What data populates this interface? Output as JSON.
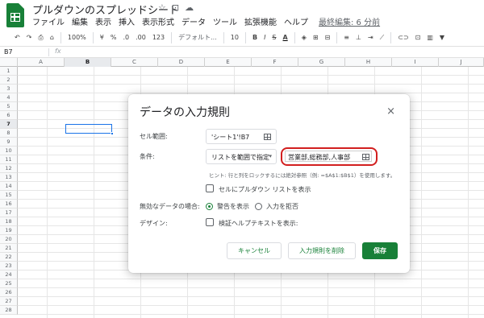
{
  "document": {
    "title": "プルダウンのスプレッドシート",
    "title_icons": [
      "☆",
      "⊡",
      "☁"
    ],
    "last_edit": "最終編集: 6 分前"
  },
  "menu": [
    "ファイル",
    "編集",
    "表示",
    "挿入",
    "表示形式",
    "データ",
    "ツール",
    "拡張機能",
    "ヘルプ"
  ],
  "toolbar": {
    "zoom": "100%",
    "currency": "¥",
    "percent": "%",
    "decimal_decrease": ".0",
    "decimal_increase": ".00",
    "number_format": "123",
    "font": "デフォルト...",
    "font_size": "10",
    "bold": "B",
    "italic": "I",
    "strike": "S",
    "text_color": "A"
  },
  "formula_bar": {
    "cell_ref": "B7",
    "fx": "fx"
  },
  "sheet": {
    "columns": [
      "A",
      "B",
      "C",
      "D",
      "E",
      "F",
      "G",
      "H",
      "I",
      "J"
    ],
    "selected_column": "B",
    "rows": [
      "1",
      "2",
      "3",
      "4",
      "5",
      "6",
      "7",
      "8",
      "9",
      "10",
      "11",
      "12",
      "13",
      "14",
      "15",
      "16",
      "17",
      "18",
      "19",
      "20",
      "21",
      "22",
      "23",
      "24",
      "25",
      "26",
      "27",
      "28"
    ],
    "selected_row": "7"
  },
  "dialog": {
    "title": "データの入力規則",
    "close": "×",
    "range_label": "セル範囲:",
    "range_value": "'シート1'!B7",
    "criteria_label": "条件:",
    "criteria_type": "リストを範囲で指定",
    "criteria_values": "営業部,総務部,人事部",
    "hint": "ヒント: 行と列をロックするには絶対参照（例: =$A$1:$B$1）を使用します。",
    "show_dropdown": "セルにプルダウン リストを表示",
    "invalid_label": "無効なデータの場合:",
    "invalid_warn": "警告を表示",
    "invalid_reject": "入力を拒否",
    "appearance_label": "デザイン:",
    "help_text": "検証ヘルプテキストを表示:",
    "cancel": "キャンセル",
    "remove": "入力規則を削除",
    "save": "保存"
  },
  "colors": {
    "brand_green": "#188038",
    "selection_blue": "#1a73e8",
    "highlight_red": "#d21f1f"
  }
}
